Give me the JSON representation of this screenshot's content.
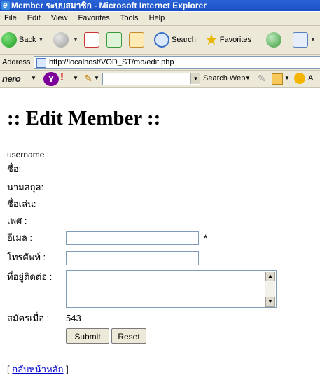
{
  "window": {
    "title": "Member ระบบสมาชิก - Microsoft Internet Explorer"
  },
  "menu": [
    "File",
    "Edit",
    "View",
    "Favorites",
    "Tools",
    "Help"
  ],
  "toolbar": {
    "back_label": "Back",
    "search_label": "Search",
    "favorites_label": "Favorites"
  },
  "address": {
    "label": "Address",
    "url": "http://localhost/VOD_ST/mb/edit.php"
  },
  "nerobar": {
    "logo": "nero",
    "yahoo": "Y",
    "exclaim": "!",
    "search_web_label": "Search Web"
  },
  "page": {
    "title": ":: Edit Member ::",
    "fields": {
      "username_label": "username :",
      "name_label": "ชื่อ:",
      "surname_label": "นามสกุล:",
      "nickname_label": "ชื่อเล่น:",
      "gender_label": "เพศ :",
      "email_label": "อีเมล :",
      "phone_label": "โทรศัพท์ :",
      "address_label": "ที่อยู่ติดต่อ :",
      "registered_label": "สมัครเมื่อ :",
      "registered_value": "543",
      "required_mark": "*"
    },
    "submit_label": "Submit",
    "reset_label": "Reset",
    "back_link_open": "[",
    "back_link_text": "กลับหน้าหลัก",
    "back_link_close": "]"
  }
}
